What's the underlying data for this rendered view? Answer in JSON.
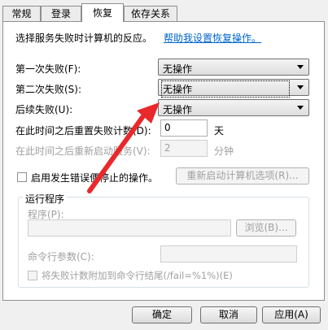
{
  "tabs": [
    "常规",
    "登录",
    "恢复",
    "依存关系"
  ],
  "active_tab": 2,
  "intro": {
    "text": "选择服务失败时计算机的反应。",
    "help_link": "帮助我设置恢复操作。"
  },
  "failures": {
    "first_label": "第一次失败(F):",
    "first_value": "无操作",
    "second_label": "第二次失败(S):",
    "second_value": "无操作",
    "subsequent_label": "后续失败(U):",
    "subsequent_value": "无操作"
  },
  "reset": {
    "label": "在此时间之后重置失败计数(D):",
    "value": "0",
    "unit": "天"
  },
  "restart": {
    "label": "在此时间之后重新启动服务(V):",
    "value": "2",
    "unit": "分钟"
  },
  "enable_actions": {
    "label": "启用发生错误便停止的操作。",
    "checked": false
  },
  "restart_computer_button": "重新启动计算机选项(R)...",
  "run_program": {
    "title": "运行程序",
    "program_label": "程序(P):",
    "program_value": "",
    "browse_button": "浏览(B)...",
    "params_label": "命令行参数(C):",
    "params_value": "",
    "append_label": "将失败计数附加到命令行结尾(/fail=%1%)(E)"
  },
  "footer": {
    "ok": "确定",
    "cancel": "取消",
    "apply": "应用(A)"
  },
  "colors": {
    "annotation_arrow": "#e8282b",
    "link": "#0066cc"
  }
}
